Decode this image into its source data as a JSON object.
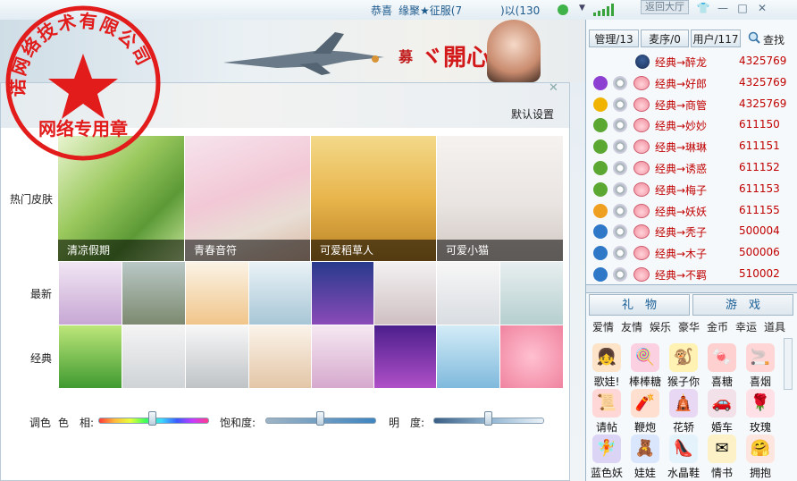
{
  "topbar": {
    "greeting": "恭喜",
    "user_text": "缘聚★征服(7",
    "user_text_tail": ")以(130",
    "back_hall": "返回大厅",
    "minimize": "—",
    "maximize": "□",
    "close": "✕"
  },
  "banner": {
    "logo_text": "ヾ開心∮慕",
    "left_char": "募"
  },
  "dialog": {
    "default_settings": "默认设置",
    "close": "✕",
    "rows": {
      "hot": "热门皮肤",
      "new": "最新",
      "classic": "经典"
    },
    "hot_skins": [
      "清凉假期",
      "青春音符",
      "可爱稻草人",
      "可爱小猫"
    ],
    "sliders": {
      "section_label": "调色",
      "hue_label": "色　相:",
      "saturation_label": "饱和度:",
      "brightness_label": "明　度:",
      "hue_value": 0.49,
      "saturation_value": 0.5,
      "brightness_value": 0.5
    }
  },
  "right_panel": {
    "tabs": [
      "管理/13",
      "麦序/0",
      "用户/117"
    ],
    "search": "查找",
    "users": [
      {
        "name": "经典→醉龙",
        "id": "4325769"
      },
      {
        "name": "经典→好郎",
        "id": "4325769"
      },
      {
        "name": "经典→商管",
        "id": "4325769"
      },
      {
        "name": "经典→妙妙",
        "id": "611150"
      },
      {
        "name": "经典→琳琳",
        "id": "611151"
      },
      {
        "name": "经典→诱惑",
        "id": "611152"
      },
      {
        "name": "经典→梅子",
        "id": "611153"
      },
      {
        "name": "经典→妖妖",
        "id": "611155"
      },
      {
        "name": "经典→秃子",
        "id": "500004"
      },
      {
        "name": "经典→木子",
        "id": "500006"
      },
      {
        "name": "经典→不羁",
        "id": "510002"
      }
    ],
    "gift_tabs": [
      "礼　物",
      "游　戏"
    ],
    "gift_categories": [
      "爱情",
      "友情",
      "娱乐",
      "豪华",
      "金币",
      "幸运",
      "道具"
    ],
    "gifts": [
      "歌娃!",
      "棒棒糖",
      "猴子你",
      "喜糖",
      "喜烟",
      "请帖",
      "鞭炮",
      "花轿",
      "婚车",
      "玫瑰",
      "蓝色妖",
      "娃娃",
      "水晶鞋",
      "情书",
      "拥抱"
    ]
  },
  "seal": {
    "company": "诺网络技术有限公司",
    "bottom": "网络专用章"
  },
  "colors": {
    "accent": "#1a5f96",
    "username_red": "#c00000",
    "seal_red": "#e21b1b"
  }
}
